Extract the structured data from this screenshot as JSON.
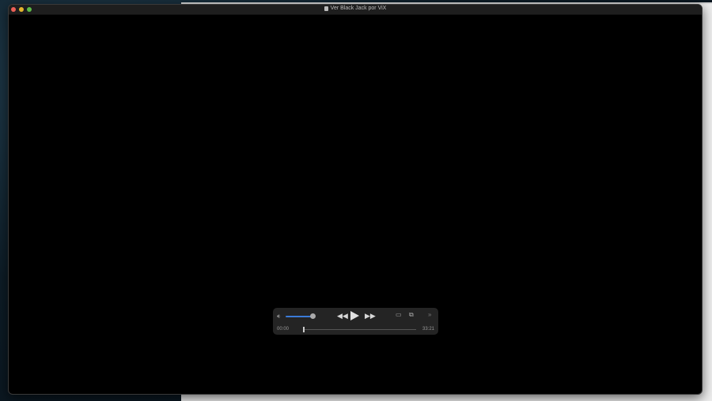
{
  "window": {
    "title": "Ver Black Jack por ViX",
    "traffic_lights": {
      "close": "#ec5f56",
      "minimize": "#e4b52d",
      "zoom": "#5dbb47"
    }
  },
  "player": {
    "current_time": "00:00",
    "duration": "33:21",
    "volume": 1.0,
    "progress": 0.0,
    "icons": [
      "speaker-icon",
      "rewind-icon",
      "play-icon",
      "fast-forward-icon",
      "airplay-icon",
      "picture-in-picture-icon",
      "more-chevron-icon"
    ]
  }
}
